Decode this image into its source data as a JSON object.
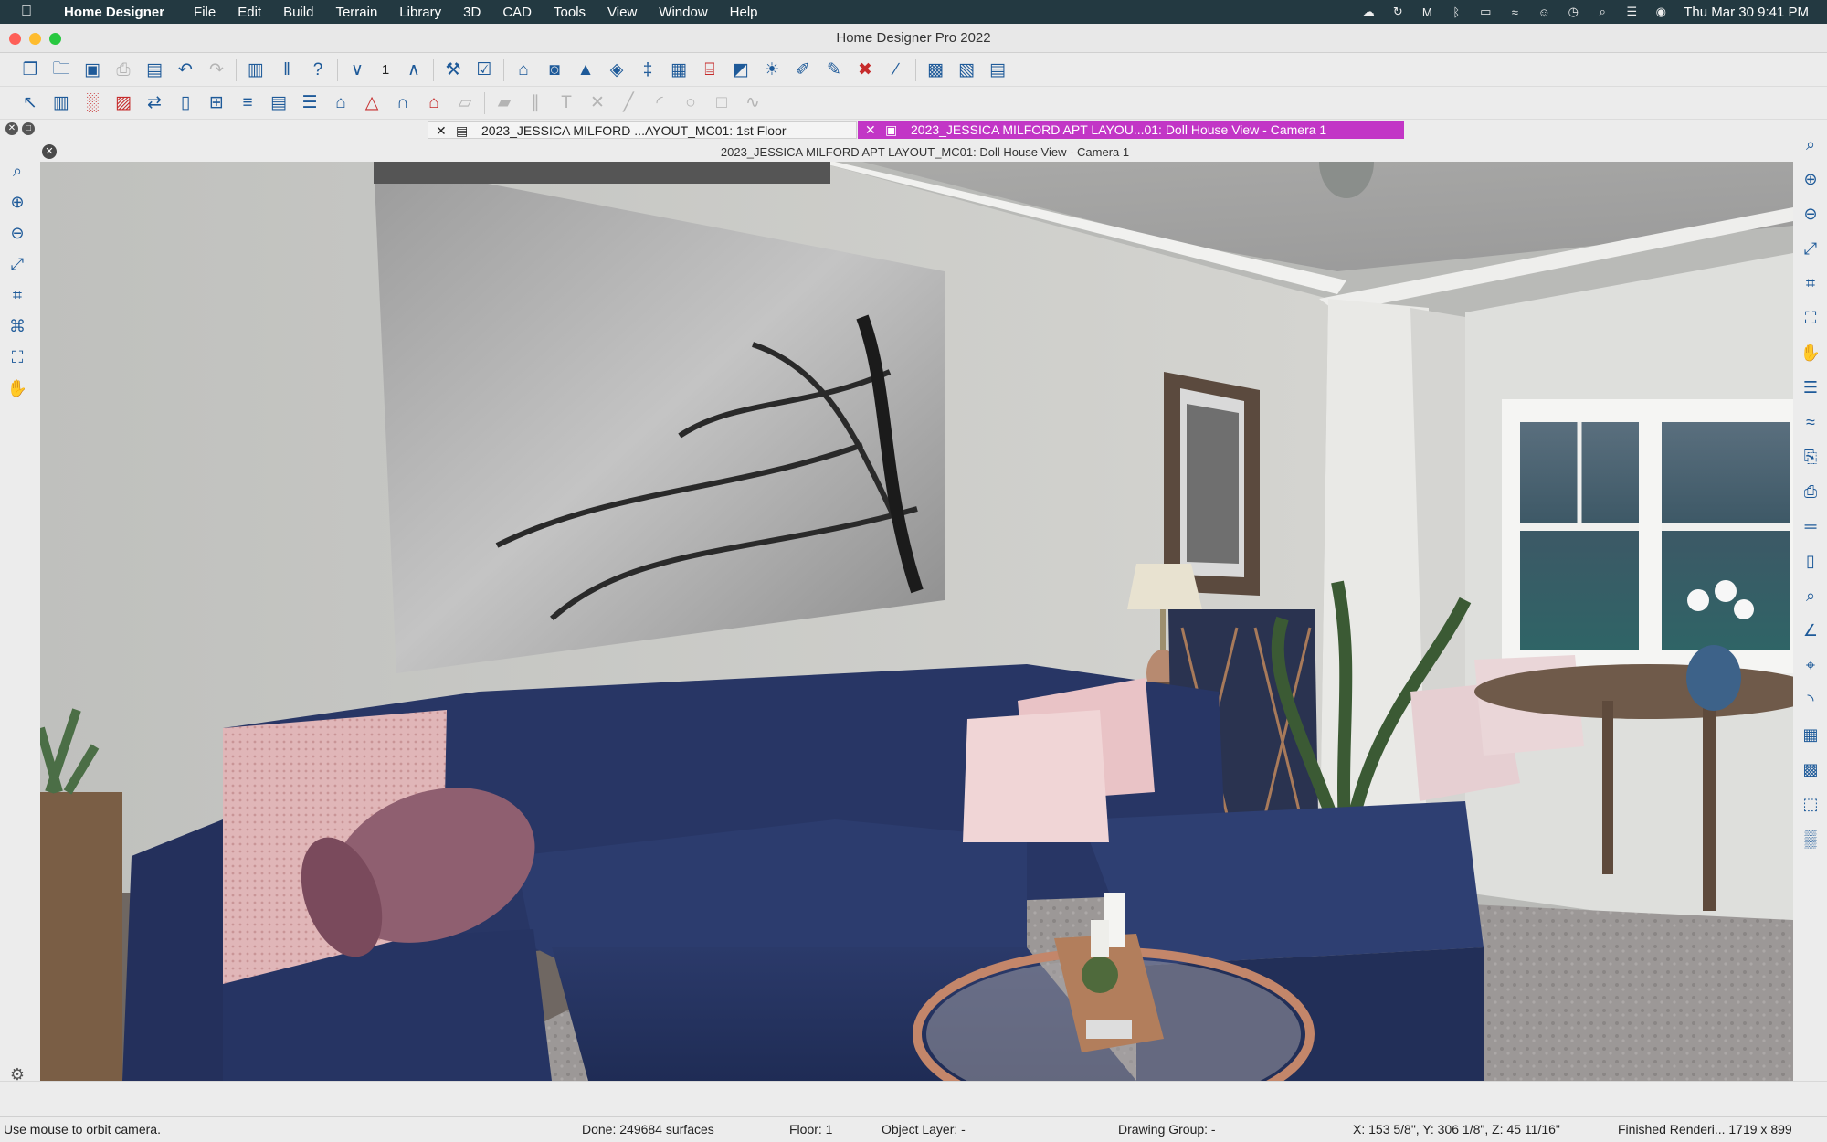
{
  "menubar": {
    "app_name": "Home Designer",
    "items": [
      "File",
      "Edit",
      "Build",
      "Terrain",
      "Library",
      "3D",
      "CAD",
      "Tools",
      "View",
      "Window",
      "Help"
    ],
    "clock": "Thu Mar 30  9:41 PM",
    "status_icons": [
      "creative-cloud-icon",
      "cloud-sync-icon",
      "malwarebytes-icon",
      "bluetooth-icon",
      "battery-icon",
      "wifi-icon",
      "user-icon",
      "time-machine-icon",
      "spotlight-icon",
      "control-center-icon",
      "siri-icon"
    ]
  },
  "window": {
    "title": "Home Designer Pro 2022",
    "traffic_colors": [
      "#fe5f57",
      "#febc2e",
      "#28c840"
    ]
  },
  "toolbar1": {
    "icons": [
      "new-file-icon",
      "open-folder-icon",
      "save-icon",
      "print-icon",
      "presentation-icon",
      "undo-icon",
      "redo-icon",
      "|",
      "plan-icon",
      "library-icon",
      "help-icon",
      "|",
      "down-floor-icon",
      "FLOOR",
      "up-floor-icon",
      "|",
      "tools-icon",
      "checklist-icon",
      "|",
      "house-icon",
      "camera-icon",
      "elevation-icon",
      "perspective-icon",
      "walk-icon",
      "framing-icon",
      "cross-section-icon",
      "doll-house-icon",
      "lightbulb-icon",
      "eyedropper-icon",
      "paint-icon",
      "delete-material-icon",
      "ruler-pencil-icon",
      "|",
      "render-icon",
      "image-icon",
      "layout-icon"
    ],
    "floor_number": "1"
  },
  "toolbar2": {
    "icons": [
      "select-arrow-icon",
      "wall-icon",
      "railing-icon",
      "cabinet-icon",
      "dimension-icon",
      "door-icon",
      "window-icon",
      "stairs-icon",
      "shelf-icon",
      "layers-icon",
      "building-icon",
      "roof-icon",
      "porch-icon",
      "house-red-icon",
      "slab-icon",
      "|",
      "terrain-icon",
      "road-icon",
      "text-icon",
      "line-x-icon",
      "line-icon",
      "arc-icon",
      "circle-icon",
      "box-icon",
      "spline-icon"
    ]
  },
  "tabs": [
    {
      "label": "2023_JESSICA MILFORD ...AYOUT_MC01: 1st Floor",
      "active": false
    },
    {
      "label": "2023_JESSICA MILFORD APT LAYOU...01: Doll House View - Camera 1",
      "active": true
    }
  ],
  "view_title": "2023_JESSICA MILFORD APT LAYOUT_MC01: Doll House View - Camera 1",
  "left_tools": [
    "zoom-icon",
    "zoom-in-icon",
    "zoom-out-icon",
    "zoom-fill-icon",
    "fit-window-icon",
    "fit-view-icon",
    "fill-window-icon",
    "pan-hand-icon"
  ],
  "right_tools": [
    "zoom-icon",
    "zoom-in-icon",
    "zoom-out-icon",
    "zoom-fill-icon",
    "fit-window-icon",
    "fill-window-icon",
    "pan-hand-icon",
    "layers-icon",
    "wave-icon",
    "copy-icon",
    "paste-icon",
    "wall-tool-icon",
    "door-tool-icon",
    "find-icon",
    "angle-icon",
    "snap-icon",
    "arc-snap-icon",
    "grid-icon",
    "grid-dark-icon",
    "transform-icon",
    "texture-icon"
  ],
  "settings_icon": "gear-icon",
  "status": {
    "hint": "Use mouse to orbit camera.",
    "done": "Done:  249684 surfaces",
    "floor": "Floor: 1",
    "object_layer": "Object Layer: -",
    "drawing_group": "Drawing Group: -",
    "coords": "X: 153 5/8\", Y: 306 1/8\", Z: 45 11/16\"",
    "render": "Finished Renderi...   1719 x 899"
  }
}
